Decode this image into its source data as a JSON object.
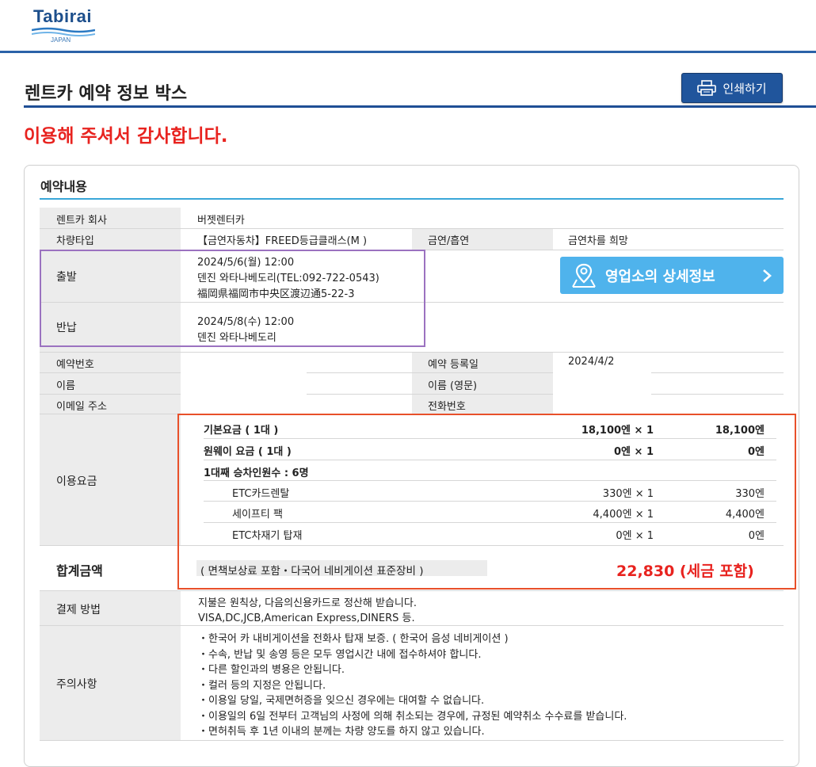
{
  "header": {
    "logo_brand": "Tabirai",
    "logo_sub": "JAPAN",
    "page_title": "렌트카 예약 정보 박스",
    "print_label": "인쇄하기",
    "thanks": "이용해 주셔서 감사합니다."
  },
  "reservation": {
    "section_title": "예약내용",
    "company_label": "렌트카 회사",
    "company_value": "버젯렌터카",
    "vehicle_label": "차량타입",
    "vehicle_value": "【금연자동차】FREED등급클래스(M )",
    "smoking_label": "금연/흡연",
    "smoking_value": "금연차를 희망",
    "departure_label": "출발",
    "departure_lines": [
      "2024/5/6(월) 12:00",
      "덴진 와타나베도리(TEL:092-722-0543)",
      "福岡県福岡市中央区渡辺通5-22-3"
    ],
    "return_label": "반납",
    "return_lines": [
      "2024/5/8(수) 12:00",
      "덴진 와타나베도리"
    ],
    "detail_button": "영업소의 상세정보",
    "booking_no_label": "예약번호",
    "booking_no_value": "",
    "reg_date_label": "예약 등록일",
    "reg_date_value": "2024/4/2",
    "name_label": "이름",
    "name_value": "",
    "name_en_label": "이름 (영문)",
    "name_en_value": "",
    "email_label": "이메일 주소",
    "email_value": "",
    "phone_label": "전화번호",
    "phone_value": ""
  },
  "fees": {
    "label": "이용요금",
    "rows": [
      {
        "name": "기본요금 ( 1대 )",
        "unit": "18,100엔 × 1",
        "amount": "18,100엔",
        "bold": true,
        "indent": false
      },
      {
        "name": "원웨이 요금 ( 1대 )",
        "unit": "0엔 × 1",
        "amount": "0엔",
        "bold": true,
        "indent": false
      },
      {
        "name": "1대째 승차인원수 : 6명",
        "unit": "",
        "amount": "",
        "bold": true,
        "indent": false
      },
      {
        "name": "ETC카드렌탈",
        "unit": "330엔 × 1",
        "amount": "330엔",
        "bold": false,
        "indent": true
      },
      {
        "name": "세이프티 팩",
        "unit": "4,400엔 × 1",
        "amount": "4,400엔",
        "bold": false,
        "indent": true
      },
      {
        "name": "ETC차재기 탑재",
        "unit": "0엔 × 1",
        "amount": "0엔",
        "bold": false,
        "indent": true
      }
    ],
    "total_label": "합계금액",
    "total_note": "( 면책보상료 포함・다국어 네비게이션 표준장비 )",
    "total_amount": "22,830 (세금 포함)"
  },
  "payment": {
    "label": "결제 방법",
    "lines": [
      "지불은 원칙상, 다음의신용카드로 정산해 받습니다.",
      "VISA,DC,JCB,American Express,DINERS 등."
    ]
  },
  "notes": {
    "label": "주의사항",
    "lines": [
      "・한국어 카 내비게이션을 전화사 탑재 보증. ( 한국어 음성 네비게이션 )",
      "・수속, 반납 및 송영 등은 모두 영업시간 내에 접수하셔야 합니다.",
      "・다른 할인과의 병용은 안됩니다.",
      "・컬러 등의 지정은 안됩니다.",
      "・이용일 당일, 국제면허증을 잊으신 경우에는 대여할 수 없습니다.",
      "・이용일의 6일 전부터 고객님의 사정에 의해 취소되는 경우에, 규정된 예약취소 수수료를 받습니다.",
      "・면허취득 후 1년 이내의 분께는 차량 양도를 하지 않고 있습니다."
    ]
  },
  "colors": {
    "accent": "#20559c",
    "alert": "#e8231f",
    "info_button": "#4fb3ec",
    "purple_outline": "#9b72c0",
    "orange_outline": "#e8502a"
  }
}
